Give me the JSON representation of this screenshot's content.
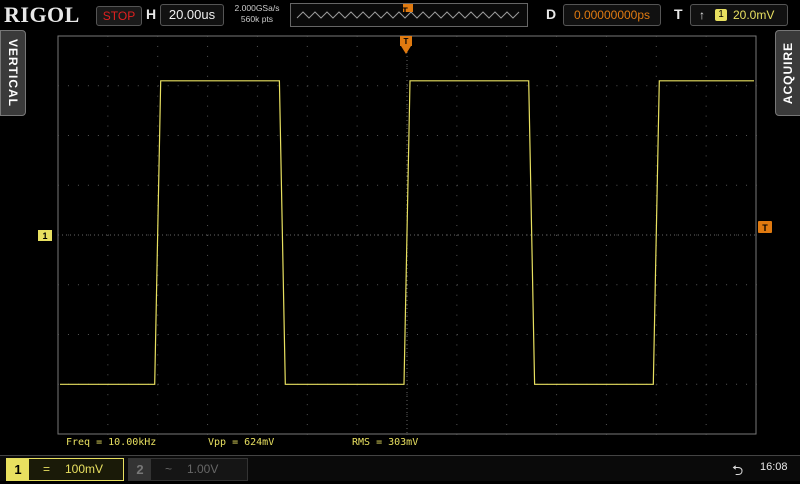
{
  "header": {
    "brand": "RIGOL",
    "run_state": "STOP",
    "horizontal_letter": "H",
    "timebase": "20.00us",
    "sample_rate": "2.000GSa/s",
    "memory_depth": "560k pts",
    "delay_letter": "D",
    "delay": "0.00000000ps",
    "trigger_letter": "T",
    "trigger_edge": "rising-edge-icon",
    "trigger_source": "1",
    "trigger_level": "20.0mV"
  },
  "side_tabs": {
    "left": "VERTICAL",
    "right": "ACQUIRE"
  },
  "markers": {
    "channel1": "1",
    "trigger_level": "T",
    "trigger_position": "T"
  },
  "measurements": {
    "freq": "Freq = 10.00kHz",
    "vpp": "Vpp = 624mV",
    "rms": "RMS = 303mV"
  },
  "channels": [
    {
      "number": "1",
      "coupling": "=",
      "scale": "100mV",
      "enabled": true
    },
    {
      "number": "2",
      "coupling": "~",
      "scale": "1.00V",
      "enabled": false
    }
  ],
  "status": {
    "usb_icon": "usb-icon",
    "time": "16:08"
  },
  "colors": {
    "ch1": "#e8e060",
    "trigger": "#e07a10",
    "stop": "#e02020",
    "grid": "#555555"
  },
  "waveform": {
    "time_per_div_us": 20,
    "volts_per_div_mV": 100,
    "frequency_kHz": 10,
    "low_div": -3.0,
    "high_div": 3.1,
    "first_rising_edge_div": -5.0
  }
}
